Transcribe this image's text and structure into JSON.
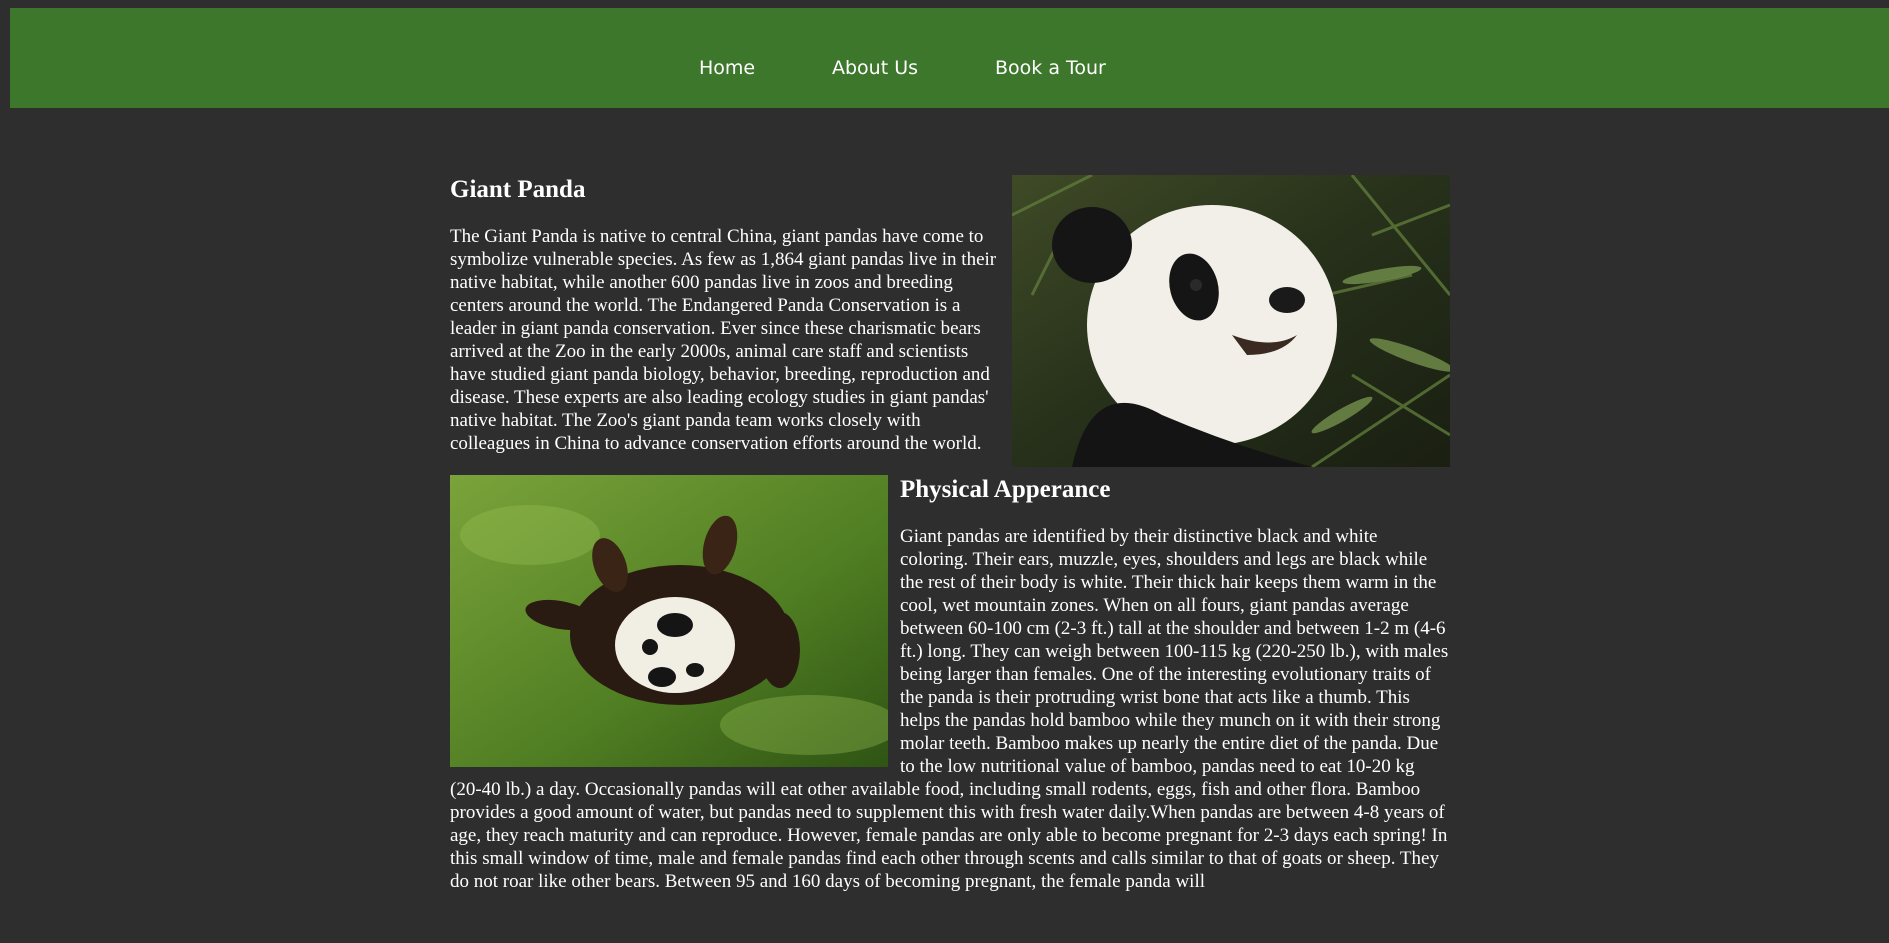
{
  "nav": {
    "items": [
      {
        "label": "Home"
      },
      {
        "label": "About Us"
      },
      {
        "label": "Book a Tour"
      }
    ]
  },
  "colors": {
    "page_background": "#2e2e2e",
    "navbar": "#3c772c",
    "text": "#ffffff"
  },
  "sections": [
    {
      "title": "Giant Panda",
      "image_name": "panda-eating-bamboo-photo",
      "body": "The Giant Panda is native to central China, giant pandas have come to symbolize vulnerable species. As few as 1,864 giant pandas live in their native habitat, while another 600 pandas live in zoos and breeding centers around the world. The Endangered Panda Conservation is a leader in giant panda conservation. Ever since these charismatic bears arrived at the Zoo in the early 2000s, animal care staff and scientists have studied giant panda biology, behavior, breeding, reproduction and disease. These experts are also leading ecology studies in giant pandas' native habitat. The Zoo's giant panda team works closely with colleagues in China to advance conservation efforts around the world."
    },
    {
      "title": "Physical Apperance",
      "image_name": "panda-rolling-on-grass-photo",
      "body": "Giant pandas are identified by their distinctive black and white coloring. Their ears, muzzle, eyes, shoulders and legs are black while the rest of their body is white. Their thick hair keeps them warm in the cool, wet mountain zones. When on all fours, giant pandas average between 60-100 cm (2-3 ft.) tall at the shoulder and between 1-2 m (4-6 ft.) long. They can weigh between 100-115 kg (220-250 lb.), with males being larger than females. One of the interesting evolutionary traits of the panda is their protruding wrist bone that acts like a thumb. This helps the pandas hold bamboo while they munch on it with their strong molar teeth. Bamboo makes up nearly the entire diet of the panda. Due to the low nutritional value of bamboo, pandas need to eat 10-20 kg (20-40 lb.) a day. Occasionally pandas will eat other available food, including small rodents, eggs, fish and other flora. Bamboo provides a good amount of water, but pandas need to supplement this with fresh water daily.When pandas are between 4-8 years of age, they reach maturity and can reproduce. However, female pandas are only able to become pregnant for 2-3 days each spring! In this small window of time, male and female pandas find each other through scents and calls similar to that of goats or sheep. They do not roar like other bears. Between 95 and 160 days of becoming pregnant, the female panda will"
    }
  ]
}
